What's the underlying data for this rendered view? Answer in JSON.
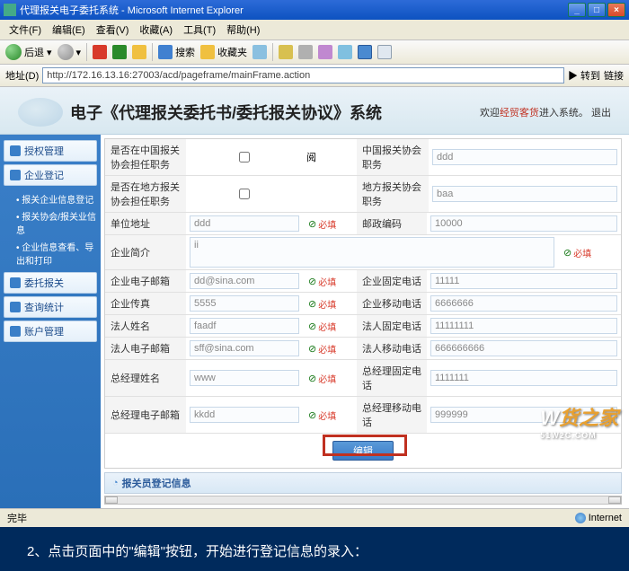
{
  "window": {
    "title": "代理报关电子委托系统 - Microsoft Internet Explorer"
  },
  "menubar": [
    "文件(F)",
    "编辑(E)",
    "查看(V)",
    "收藏(A)",
    "工具(T)",
    "帮助(H)"
  ],
  "toolbar": {
    "back": "后退",
    "search": "搜索",
    "fav": "收藏夹"
  },
  "addrbar": {
    "label": "地址(D)",
    "url": "http://172.16.13.16:27003/acd/pageframe/mainFrame.action",
    "go": "转到",
    "links": "链接"
  },
  "page": {
    "title": "电子《代理报关委托书/委托报关协议》系统",
    "welcome_pre": "欢迎",
    "user": "经贸客货",
    "welcome_post": "进入系统。",
    "logout": "退出"
  },
  "sidebar": {
    "items": [
      {
        "label": "授权管理"
      },
      {
        "label": "企业登记",
        "sub": [
          "报关企业信息登记",
          "报关协会/报关业信息",
          "企业信息查看、导出和打印"
        ]
      },
      {
        "label": "委托报关"
      },
      {
        "label": "查询统计"
      },
      {
        "label": "账户管理"
      }
    ]
  },
  "form": {
    "l_china_assoc": "是否在中国报关协会担任职务",
    "v_china_assoc": "阅",
    "l_china_pos": "中国报关协会职务",
    "v_china_pos": "ddd",
    "l_local_assoc": "是否在地方报关协会担任职务",
    "l_local_pos": "地方报关协会职务",
    "v_local_pos": "baa",
    "l_addr": "单位地址",
    "v_addr": "ddd",
    "l_zip": "邮政编码",
    "v_zip": "10000",
    "l_intro": "企业简介",
    "v_intro": "ii",
    "l_email": "企业电子邮箱",
    "v_email": "dd@sina.com",
    "l_tel": "企业固定电话",
    "v_tel": "11111",
    "l_fax": "企业传真",
    "v_fax": "5555",
    "l_mobile": "企业移动电话",
    "v_mobile": "6666666",
    "l_legal": "法人姓名",
    "v_legal": "faadf",
    "l_legal_tel": "法人固定电话",
    "v_legal_tel": "11111111",
    "l_legal_email": "法人电子邮箱",
    "v_legal_email": "sff@sina.com",
    "l_legal_mobile": "法人移动电话",
    "v_legal_mobile": "666666666",
    "l_mgr": "总经理姓名",
    "v_mgr": "www",
    "l_mgr_tel": "总经理固定电话",
    "v_mgr_tel": "1111111",
    "l_mgr_email": "总经理电子邮箱",
    "v_mgr_email": "kkdd",
    "l_mgr_mobile": "总经理移动电话",
    "v_mgr_mobile": "999999",
    "req": "必填",
    "btn_edit": "编辑",
    "section": "报关员登记信息"
  },
  "status": {
    "done": "完毕",
    "zone": "Internet"
  },
  "caption": "2、点击页面中的\"编辑\"按钮，开始进行登记信息的录入：",
  "watermark": {
    "main": "货之家",
    "sub": "51W2C.COM"
  }
}
